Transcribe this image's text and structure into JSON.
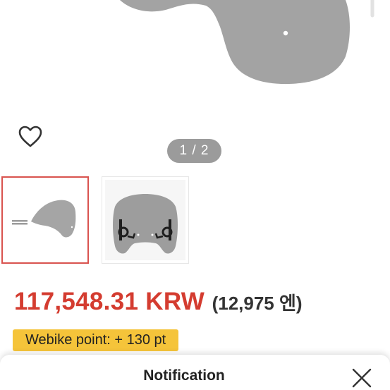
{
  "gallery": {
    "counter": "1 / 2",
    "current_index": 1,
    "total": 2,
    "wishlist_icon": "heart-outline-icon",
    "thumbnails": [
      {
        "label": "windscreen side view",
        "selected": true
      },
      {
        "label": "windscreen front view with mounts",
        "selected": false
      }
    ]
  },
  "price": {
    "main": "117,548.31 KRW",
    "secondary": "(12,975 엔)",
    "color": "#d43c30"
  },
  "points": {
    "label": "Webike point: + 130 pt",
    "color": "#f5c43a"
  },
  "notification": {
    "title": "Notification",
    "close_icon": "close-icon"
  }
}
